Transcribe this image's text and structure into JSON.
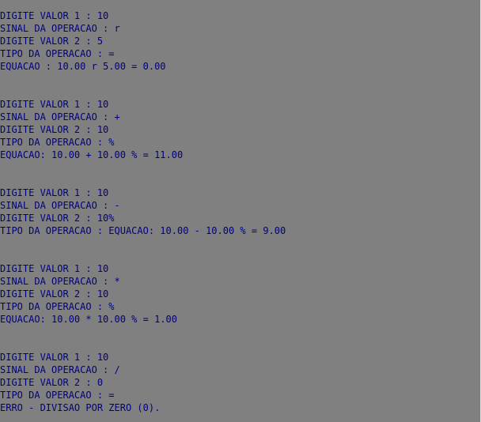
{
  "console": {
    "lines": [
      "DIGITE VALOR 1 : 10",
      "SINAL DA OPERACAO : r",
      "DIGITE VALOR 2 : 5",
      "TIPO DA OPERACAO : =",
      "EQUACAO : 10.00 r 5.00 = 0.00",
      "",
      "",
      "DIGITE VALOR 1 : 10",
      "SINAL DA OPERACAO : +",
      "DIGITE VALOR 2 : 10",
      "TIPO DA OPERACAO : %",
      "EQUACAO: 10.00 + 10.00 % = 11.00",
      "",
      "",
      "DIGITE VALOR 1 : 10",
      "SINAL DA OPERACAO : -",
      "DIGITE VALOR 2 : 10%",
      "TIPO DA OPERACAO : EQUACAO: 10.00 - 10.00 % = 9.00",
      "",
      "",
      "DIGITE VALOR 1 : 10",
      "SINAL DA OPERACAO : *",
      "DIGITE VALOR 2 : 10",
      "TIPO DA OPERACAO : %",
      "EQUACAO: 10.00 * 10.00 % = 1.00",
      "",
      "",
      "DIGITE VALOR 1 : 10",
      "SINAL DA OPERACAO : /",
      "DIGITE VALOR 2 : 0",
      "TIPO DA OPERACAO : =",
      "ERRO - DIVISAO POR ZERO (0)."
    ]
  }
}
